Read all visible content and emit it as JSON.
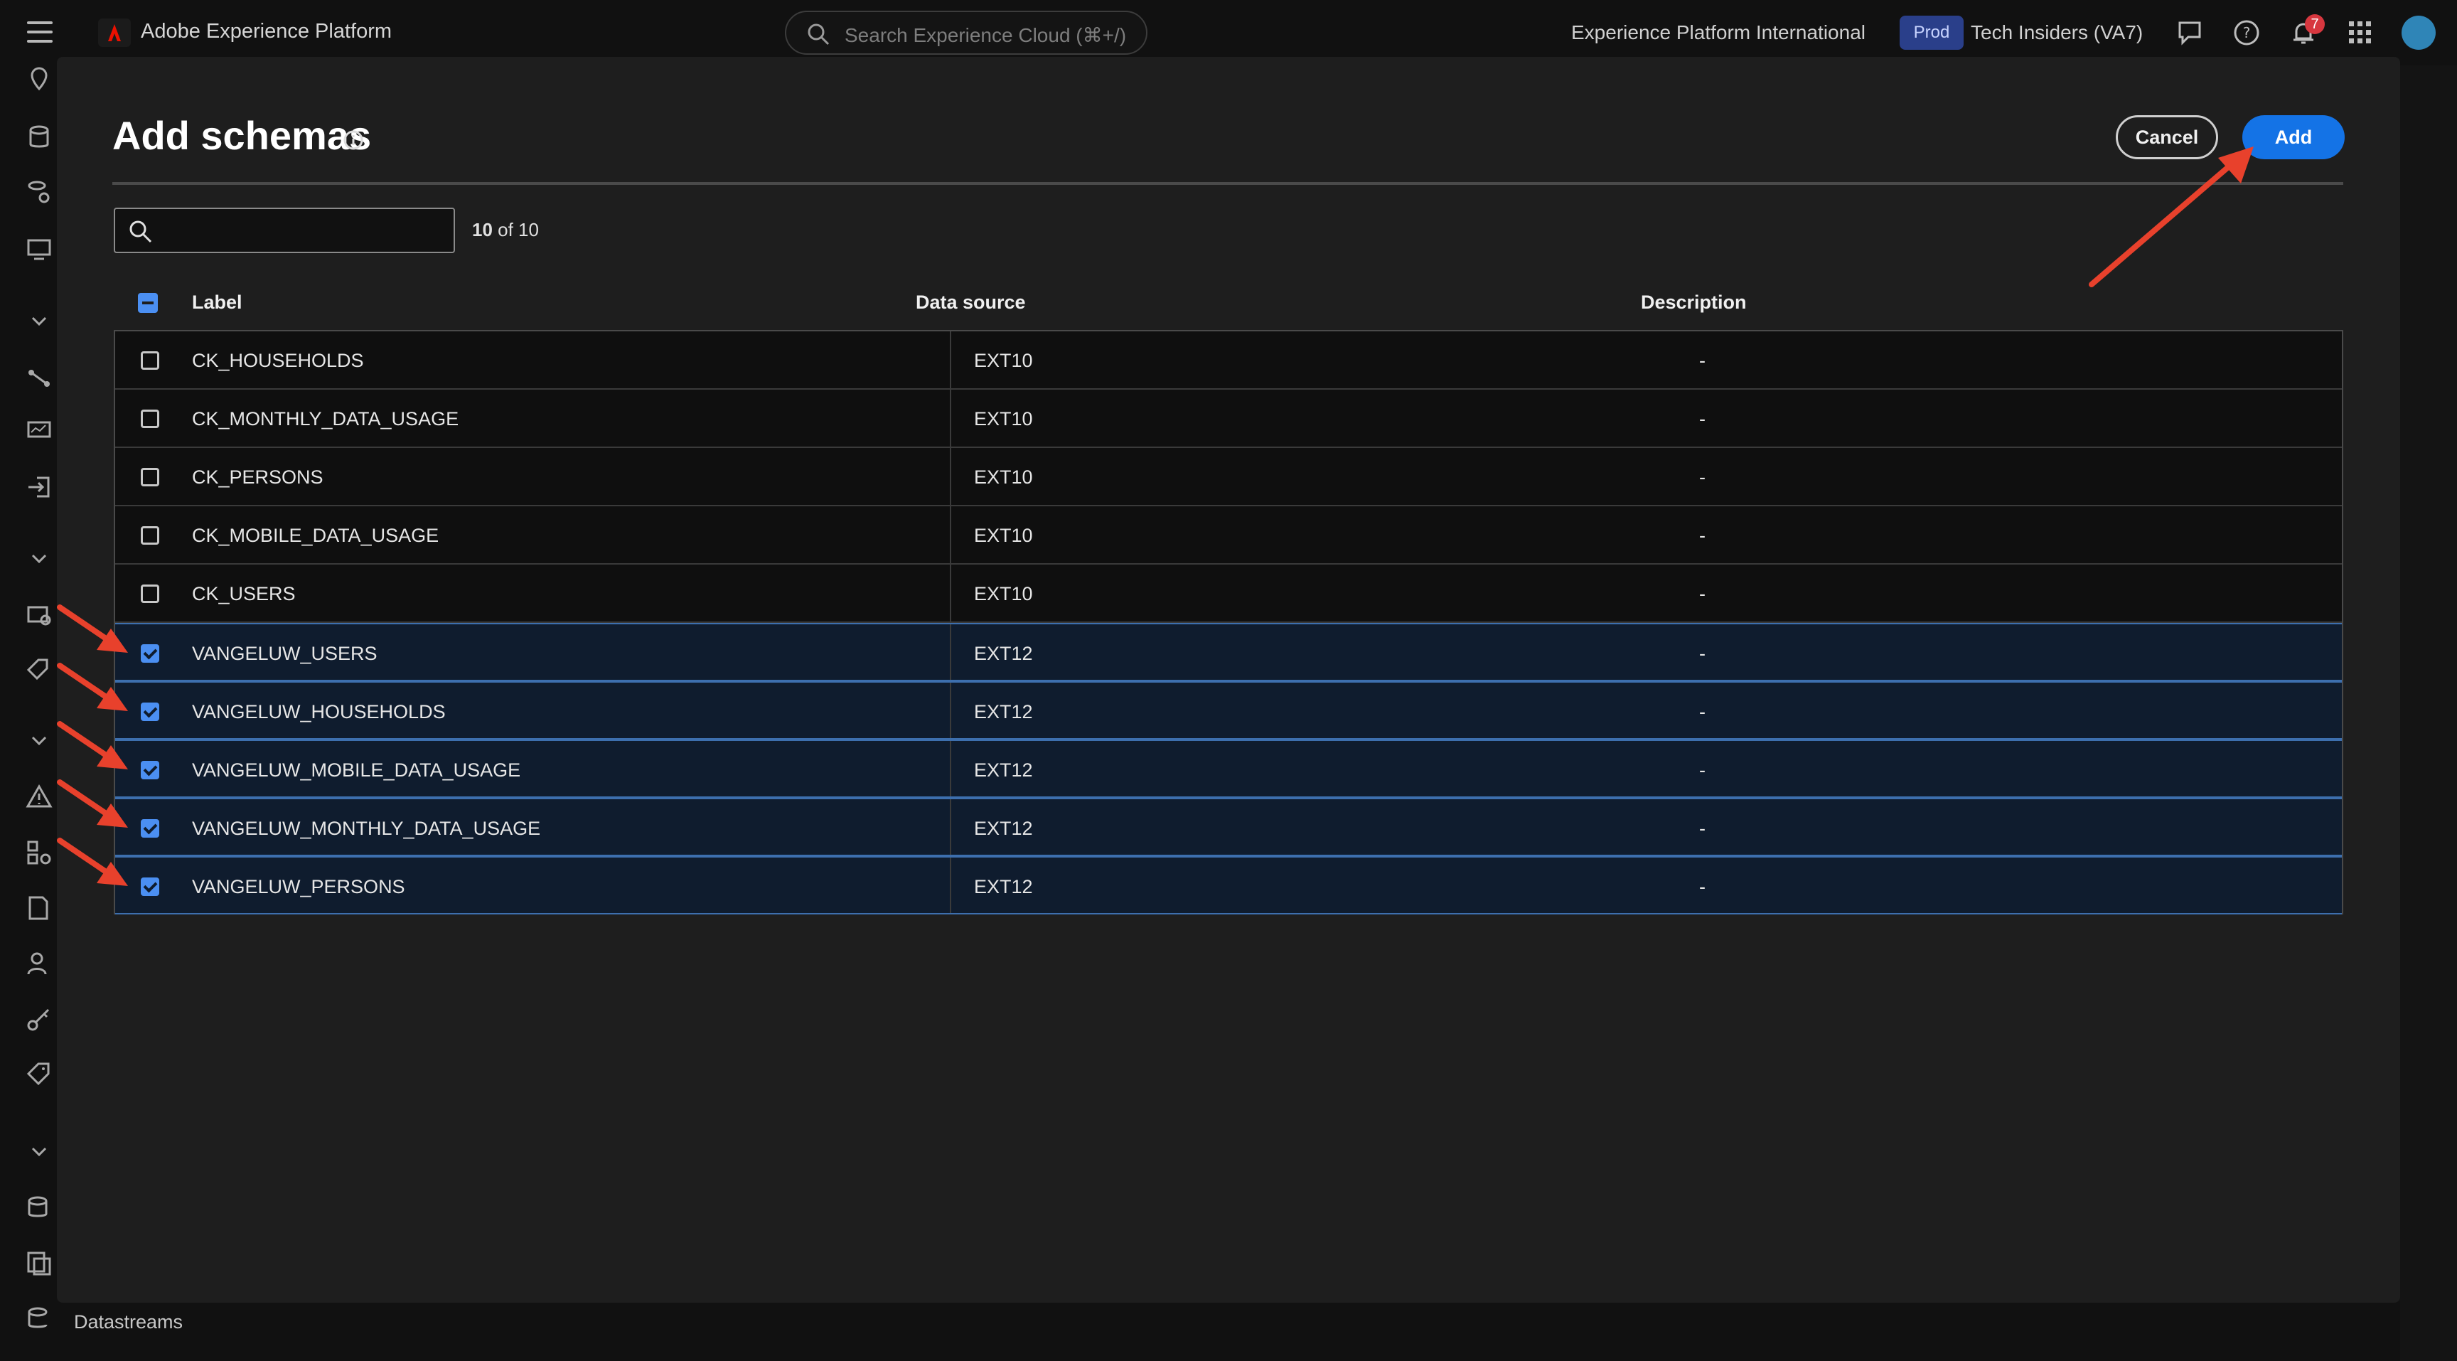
{
  "topbar": {
    "app_title": "Adobe Experience Platform",
    "search_placeholder": "Search Experience Cloud (⌘+/)",
    "org_name": "Experience Platform International",
    "env_badge": "Prod",
    "sandbox_name": "Tech Insiders (VA7)",
    "notification_count": "7"
  },
  "sidebar": {
    "footer_label": "Datastreams"
  },
  "modal": {
    "title": "Add schemas",
    "cancel_label": "Cancel",
    "add_label": "Add",
    "filter_value": "",
    "count_current": "10",
    "count_sep": " of 10",
    "columns": {
      "label": "Label",
      "data_source": "Data source",
      "description": "Description"
    },
    "rows": [
      {
        "label": "CK_HOUSEHOLDS",
        "source": "EXT10",
        "description": "-",
        "selected": false
      },
      {
        "label": "CK_MONTHLY_DATA_USAGE",
        "source": "EXT10",
        "description": "-",
        "selected": false
      },
      {
        "label": "CK_PERSONS",
        "source": "EXT10",
        "description": "-",
        "selected": false
      },
      {
        "label": "CK_MOBILE_DATA_USAGE",
        "source": "EXT10",
        "description": "-",
        "selected": false
      },
      {
        "label": "CK_USERS",
        "source": "EXT10",
        "description": "-",
        "selected": false
      },
      {
        "label": "VANGELUW_USERS",
        "source": "EXT12",
        "description": "-",
        "selected": true
      },
      {
        "label": "VANGELUW_HOUSEHOLDS",
        "source": "EXT12",
        "description": "-",
        "selected": true
      },
      {
        "label": "VANGELUW_MOBILE_DATA_USAGE",
        "source": "EXT12",
        "description": "-",
        "selected": true
      },
      {
        "label": "VANGELUW_MONTHLY_DATA_USAGE",
        "source": "EXT12",
        "description": "-",
        "selected": true
      },
      {
        "label": "VANGELUW_PERSONS",
        "source": "EXT12",
        "description": "-",
        "selected": true
      }
    ]
  },
  "colors": {
    "accent": "#1473e6",
    "selected_row": "#0f1c2e",
    "annotation_arrow": "#e8412c"
  }
}
